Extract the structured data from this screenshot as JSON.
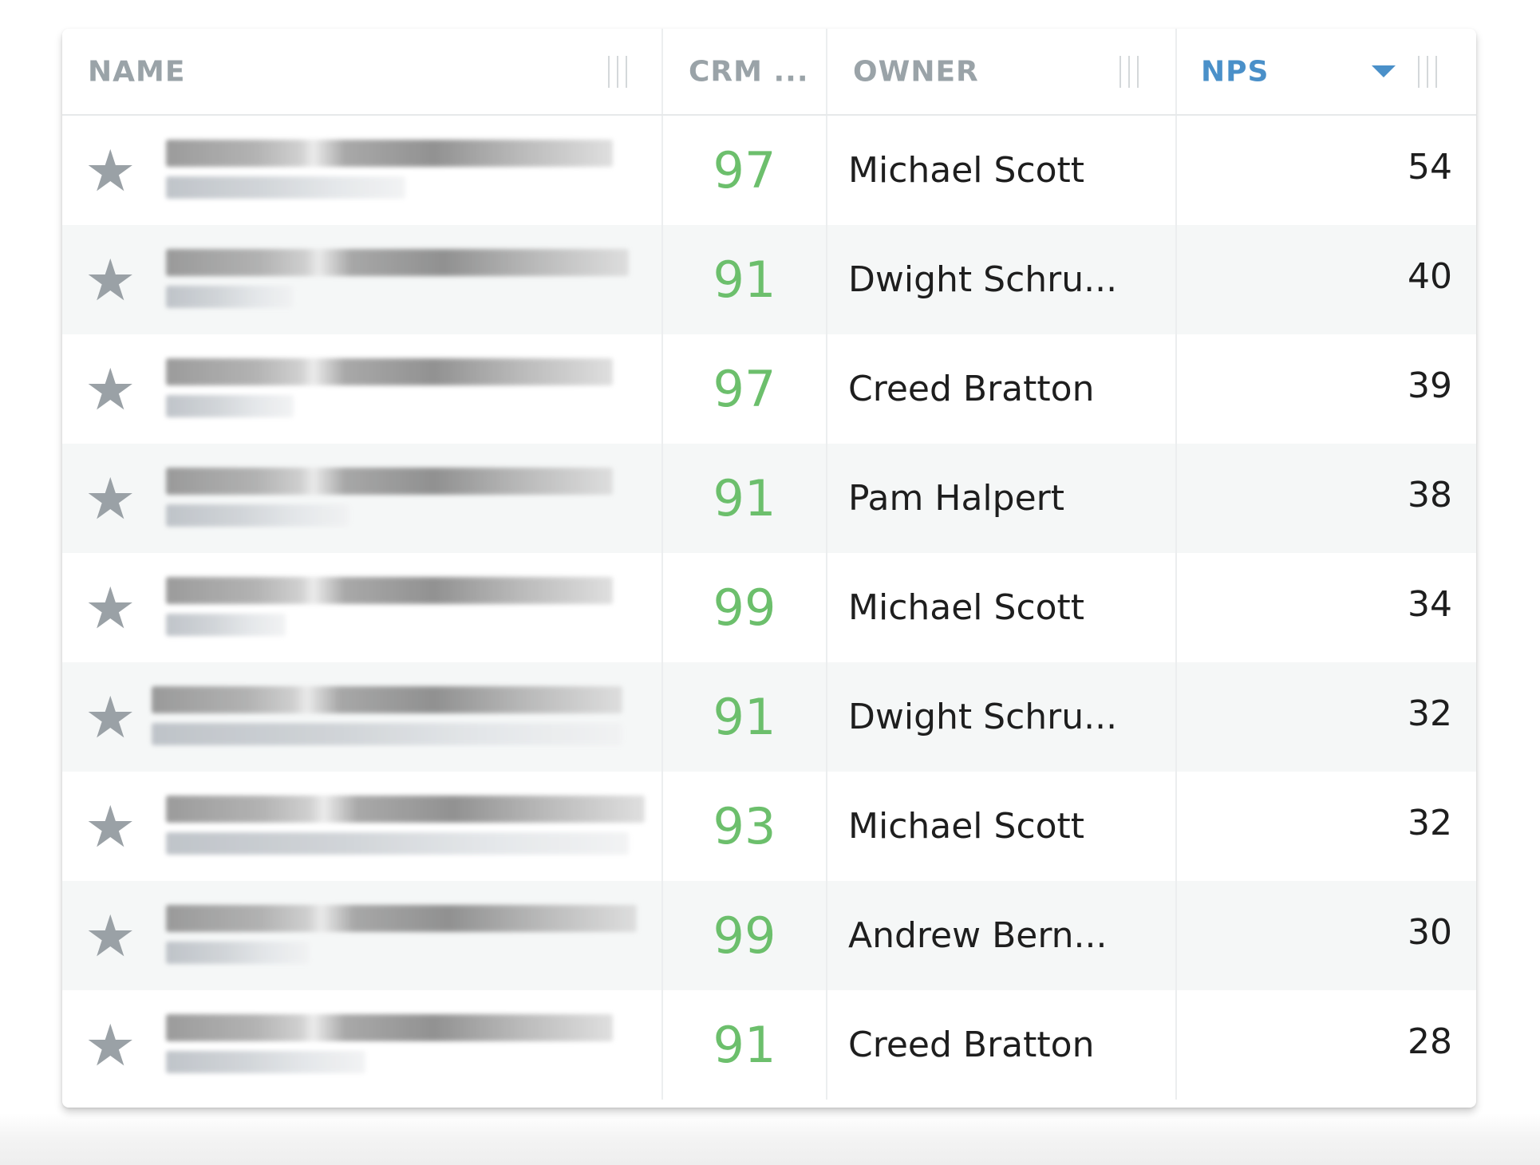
{
  "table": {
    "columns": {
      "name": "NAME",
      "crm": "CRM ...",
      "owner": "OWNER",
      "nps": "NPS"
    },
    "sort": {
      "column": "nps",
      "direction": "descending"
    },
    "rows": [
      {
        "crm": "97",
        "owner": "Michael Scott",
        "nps": "54"
      },
      {
        "crm": "91",
        "owner": "Dwight Schru...",
        "nps": "40"
      },
      {
        "crm": "97",
        "owner": "Creed Bratton",
        "nps": "39"
      },
      {
        "crm": "91",
        "owner": "Pam Halpert",
        "nps": "38"
      },
      {
        "crm": "99",
        "owner": "Michael Scott",
        "nps": "34"
      },
      {
        "crm": "91",
        "owner": "Dwight Schru...",
        "nps": "32"
      },
      {
        "crm": "93",
        "owner": "Michael Scott",
        "nps": "32"
      },
      {
        "crm": "99",
        "owner": "Andrew Bern...",
        "nps": "30"
      },
      {
        "crm": "91",
        "owner": "Creed Bratton",
        "nps": "28"
      }
    ]
  },
  "colors": {
    "crm_score": "#6cbf6c",
    "active_header": "#4a90c9",
    "header": "#9aa3a8",
    "star": "#9aa1a6"
  },
  "icons": {
    "favorite": "star-icon",
    "sort": "sort-descending-icon",
    "resize": "column-resize-handle-icon"
  }
}
